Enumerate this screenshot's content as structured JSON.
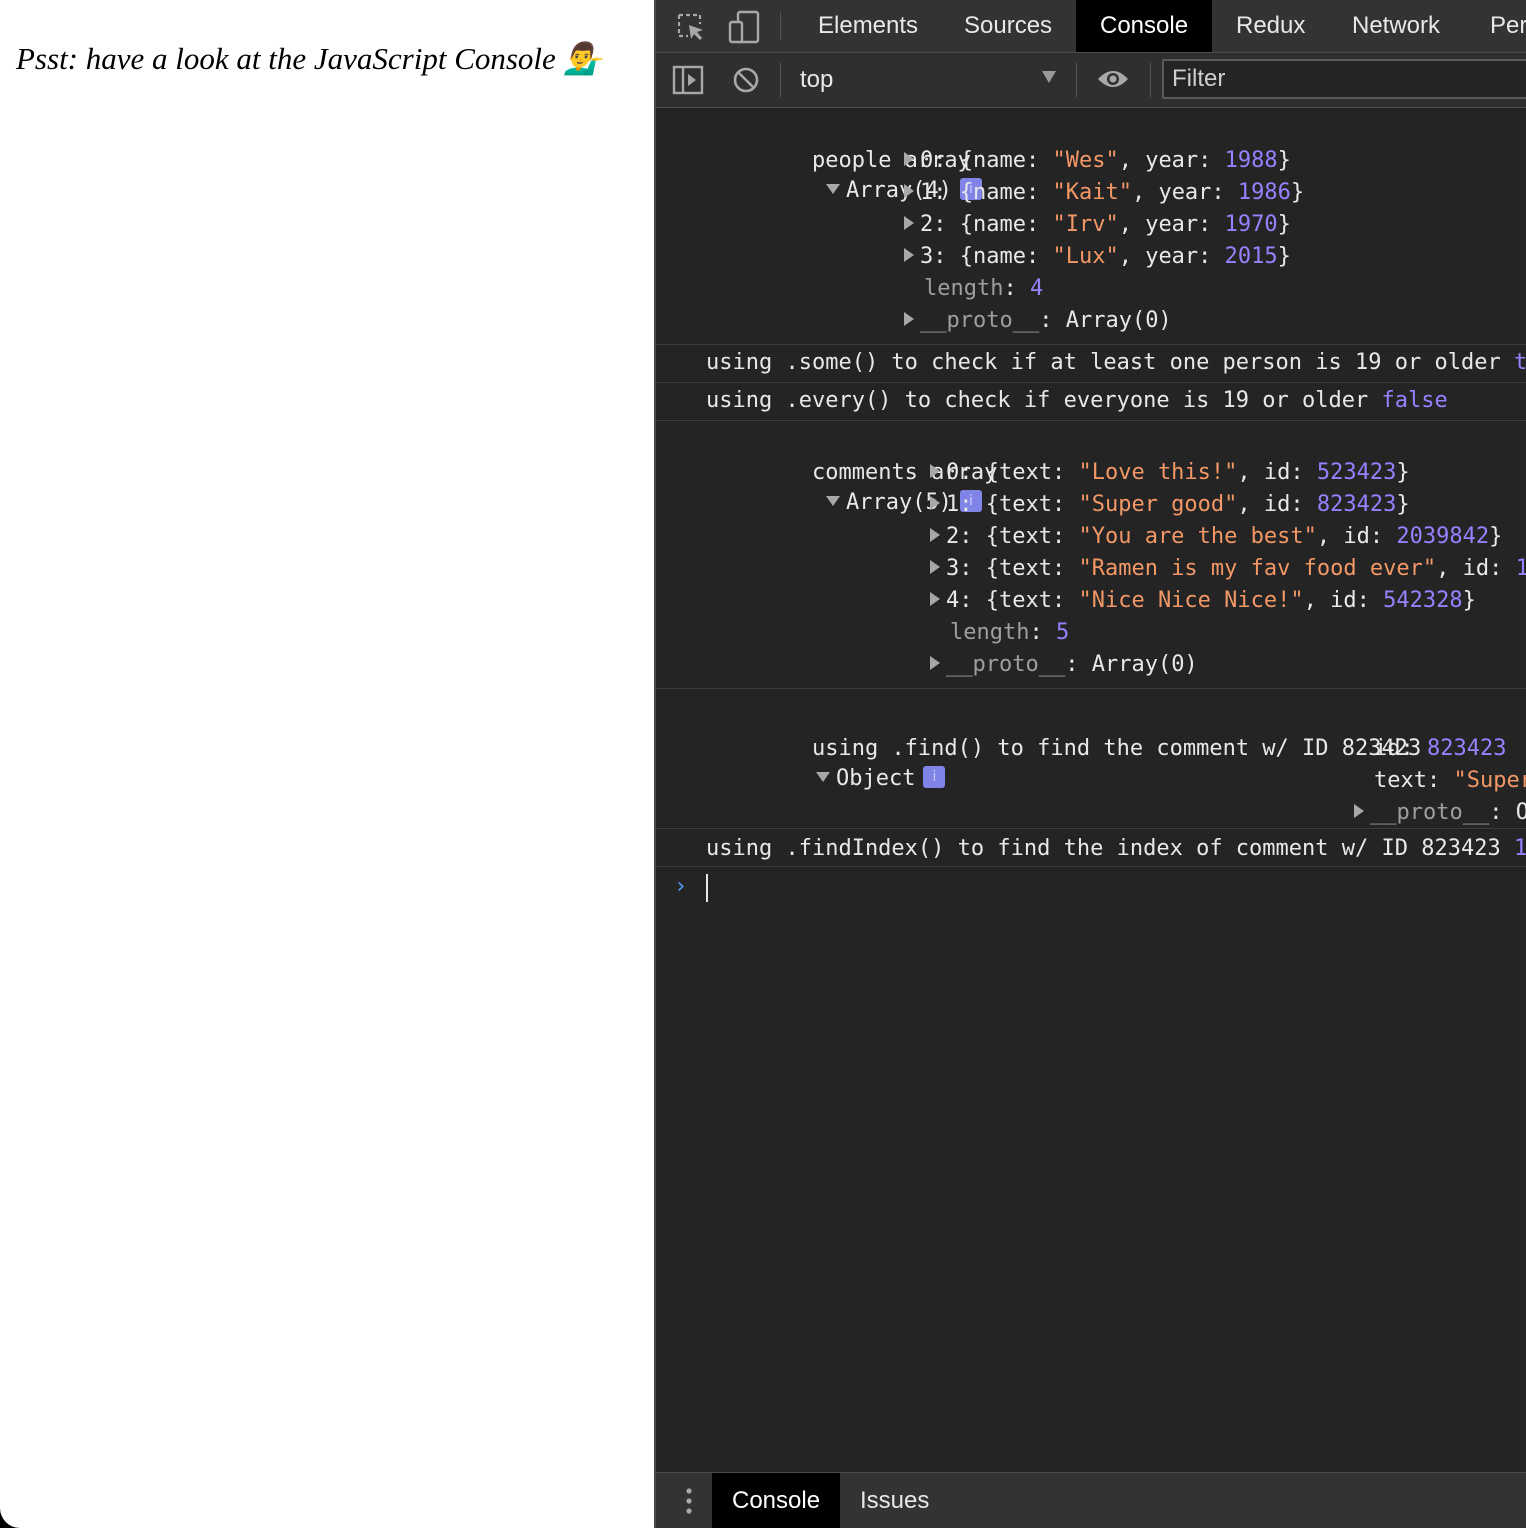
{
  "page": {
    "message": "Psst: have a look at the JavaScript Console 💁‍♂️"
  },
  "devtools": {
    "tabs": [
      "Elements",
      "Sources",
      "Console",
      "Redux",
      "Network",
      "Per"
    ],
    "active_tab": "Console",
    "toolbar": {
      "context": "top",
      "filter_placeholder": "Filter"
    },
    "messages": {
      "people": {
        "label": "people array",
        "summary": "Array(4)",
        "items": [
          {
            "index": "0",
            "name": "\"Wes\"",
            "year": "1988"
          },
          {
            "index": "1",
            "name": "\"Kait\"",
            "year": "1986"
          },
          {
            "index": "2",
            "name": "\"Irv\"",
            "year": "1970"
          },
          {
            "index": "3",
            "name": "\"Lux\"",
            "year": "2015"
          }
        ],
        "length_key": "length",
        "length": "4",
        "proto_key": "__proto__",
        "proto": "Array(0)"
      },
      "some": {
        "text": "using .some() to check if at least one person is 19 or older",
        "value": "t"
      },
      "every": {
        "text": "using .every() to check if everyone is 19 or older",
        "value": "false"
      },
      "comments": {
        "label": "comments array",
        "summary": "Array(5)",
        "items": [
          {
            "index": "0",
            "text": "\"Love this!\"",
            "id": "523423",
            "end": "}"
          },
          {
            "index": "1",
            "text": "\"Super good\"",
            "id": "823423",
            "end": "}"
          },
          {
            "index": "2",
            "text": "\"You are the best\"",
            "id": "2039842",
            "end": "}"
          },
          {
            "index": "3",
            "text": "\"Ramen is my fav food ever\"",
            "id": "1",
            "end": ""
          },
          {
            "index": "4",
            "text": "\"Nice Nice Nice!\"",
            "id": "542328",
            "end": "}"
          }
        ],
        "length_key": "length",
        "length": "5",
        "proto_key": "__proto__",
        "proto": "Array(0)"
      },
      "find": {
        "text": "using .find() to find the comment w/ ID 823423",
        "summary": "Object",
        "id_key": "id",
        "id_value": "823423",
        "text_key": "text",
        "text_value": "\"Super",
        "proto_key": "__proto__",
        "proto_value": "O"
      },
      "findIndex": {
        "text": "using .findIndex() to find the index of comment w/ ID 823423",
        "value": "1"
      }
    },
    "prompt_symbol": "›",
    "drawer_tabs": [
      "Console",
      "Issues"
    ]
  }
}
